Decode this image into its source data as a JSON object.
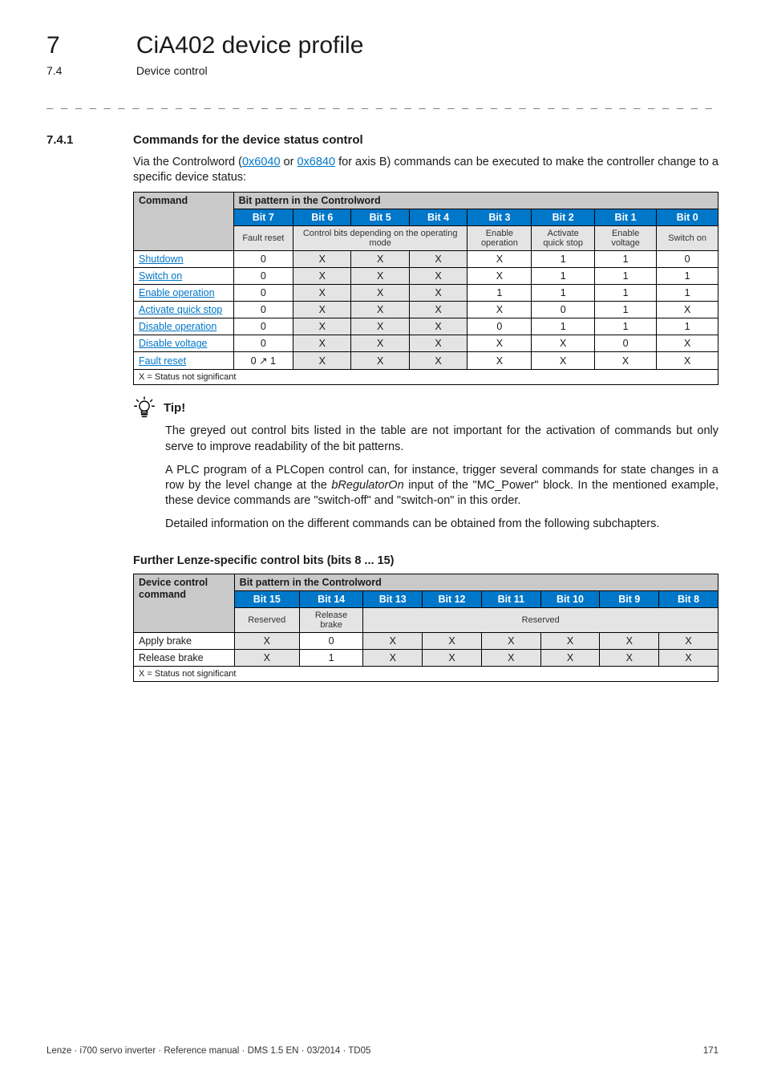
{
  "chapter": {
    "num": "7",
    "title": "CiA402 device profile"
  },
  "sub": {
    "num": "7.4",
    "title": "Device control"
  },
  "rule": "_ _ _ _ _ _ _ _ _ _ _ _ _ _ _ _ _ _ _ _ _ _ _ _ _ _ _ _ _ _ _ _ _ _ _ _ _ _ _ _ _ _ _ _ _ _ _ _ _ _ _ _ _ _ _ _ _ _ _ _ _ _ _ _",
  "section": {
    "num": "7.4.1",
    "title": "Commands for the device status control"
  },
  "intro": {
    "pre": "Via the Controlword (",
    "link1": "0x6040",
    "mid": " or ",
    "link2": "0x6840",
    "post": " for axis B) commands can be executed to make the controller change to a specific device status:"
  },
  "table1": {
    "col0": "Command",
    "spanhdr": "Bit pattern in the Controlword",
    "bits": [
      "Bit 7",
      "Bit 6",
      "Bit 5",
      "Bit 4",
      "Bit 3",
      "Bit 2",
      "Bit 1",
      "Bit 0"
    ],
    "subhdr": {
      "c0": "Fault reset",
      "cSpan": "Control bits depending on the operating mode",
      "c4": "Enable operation",
      "c5": "Activate quick stop",
      "c6": "Enable voltage",
      "c7": "Switch on"
    },
    "rows": [
      {
        "cmd": "Shutdown",
        "v": [
          "0",
          "X",
          "X",
          "X",
          "X",
          "1",
          "1",
          "0"
        ]
      },
      {
        "cmd": "Switch on",
        "v": [
          "0",
          "X",
          "X",
          "X",
          "X",
          "1",
          "1",
          "1"
        ]
      },
      {
        "cmd": "Enable operation",
        "v": [
          "0",
          "X",
          "X",
          "X",
          "1",
          "1",
          "1",
          "1"
        ]
      },
      {
        "cmd": "Activate quick stop",
        "v": [
          "0",
          "X",
          "X",
          "X",
          "X",
          "0",
          "1",
          "X"
        ]
      },
      {
        "cmd": "Disable operation",
        "v": [
          "0",
          "X",
          "X",
          "X",
          "0",
          "1",
          "1",
          "1"
        ]
      },
      {
        "cmd": "Disable voltage",
        "v": [
          "0",
          "X",
          "X",
          "X",
          "X",
          "X",
          "0",
          "X"
        ]
      },
      {
        "cmd": "Fault reset",
        "v": [
          "0 ↗ 1",
          "X",
          "X",
          "X",
          "X",
          "X",
          "X",
          "X"
        ]
      }
    ],
    "foot": "X = Status not significant"
  },
  "tip": {
    "label": "Tip!",
    "p1": "The greyed out control bits listed in the table are not important for the activation of commands but only serve to improve readability of the bit patterns.",
    "p2a": "A PLC program of a PLCopen control can, for instance, trigger several commands for state changes in a row by the level change at the ",
    "p2em": "bRegulatorOn",
    "p2b": " input of the \"MC_Power\" block. In the mentioned example, these device commands are \"switch-off\" and \"switch-on\" in this order.",
    "p3": "Detailed information on the different commands can be obtained from the following subchapters."
  },
  "subhead2": "Further Lenze-specific control bits (bits 8 ... 15)",
  "table2": {
    "col0a": "Device control",
    "col0b": "command",
    "spanhdr": "Bit pattern in the Controlword",
    "bits": [
      "Bit 15",
      "Bit 14",
      "Bit 13",
      "Bit 12",
      "Bit 11",
      "Bit 10",
      "Bit 9",
      "Bit 8"
    ],
    "subhdr": {
      "c0": "Reserved",
      "c1": "Release brake",
      "cSpan": "Reserved"
    },
    "rows": [
      {
        "cmd": "Apply brake",
        "v": [
          "X",
          "0",
          "X",
          "X",
          "X",
          "X",
          "X",
          "X"
        ]
      },
      {
        "cmd": "Release brake",
        "v": [
          "X",
          "1",
          "X",
          "X",
          "X",
          "X",
          "X",
          "X"
        ]
      }
    ],
    "foot": "X = Status not significant"
  },
  "footer": {
    "left": "Lenze · i700 servo inverter · Reference manual · DMS 1.5 EN · 03/2014 · TD05",
    "right": "171"
  }
}
